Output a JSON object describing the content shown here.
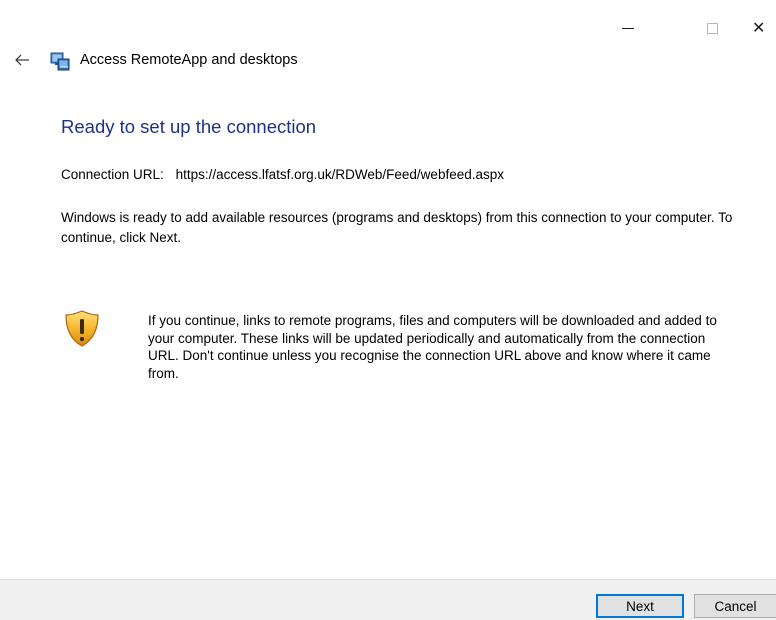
{
  "window": {
    "title": "Access RemoteApp and desktops",
    "controls": {
      "minimize_icon": "minimize-icon",
      "maximize_icon": "maximize-icon",
      "close_icon": "close-icon",
      "close_glyph": "✕"
    }
  },
  "header": {
    "back_icon": "back-arrow-icon",
    "app_icon": "remoteapp-icon",
    "title": "Access RemoteApp and desktops"
  },
  "main": {
    "heading": "Ready to set up the connection",
    "connection_label": "Connection URL:",
    "connection_url": "https://access.lfatsf.org.uk/RDWeb/Feed/webfeed.aspx",
    "description": "Windows is ready to add available resources (programs and desktops) from this connection to your computer. To continue, click Next.",
    "warning": {
      "icon": "shield-warning-icon",
      "text": "If you continue, links to remote programs, files and computers will be downloaded and added to your computer. These links will be updated periodically and automatically from the connection URL. Don't continue unless you recognise the connection URL above and know where it came from."
    }
  },
  "footer": {
    "next_label": "Next",
    "cancel_label": "Cancel"
  },
  "colors": {
    "heading": "#1e3287",
    "footer_bg": "#f0f0f0",
    "default_button_border": "#0078d7"
  }
}
